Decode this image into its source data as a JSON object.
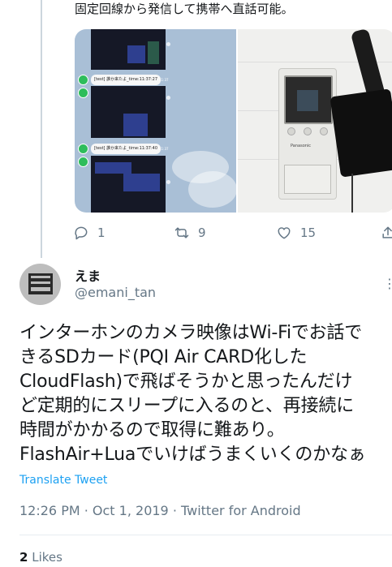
{
  "previous_tweet": {
    "text": "固定回線から発信して携帯へ直話可能。",
    "media": {
      "left_image": {
        "messages": [
          {
            "bubble": "[test] 誰か来たよ_time:11:37:27",
            "time": "11:37"
          },
          {
            "bubble": "[test] 誰か来たよ_time:11:37:40",
            "time": "11:37"
          }
        ]
      }
    },
    "actions": {
      "reply_count": "1",
      "retweet_count": "9",
      "like_count": "15"
    }
  },
  "tweet": {
    "author": {
      "display_name": "えま",
      "username": "@emani_tan"
    },
    "more_icon": "more-dots-icon",
    "text_lines": [
      "インターホンのカメラ映像はWi-Fiでお話で",
      "きるSDカード(PQI Air CARD化した",
      "CloudFlash)で飛ばそうかと思ったんだけ",
      "ど定期的にスリープに入るのと、再接続に",
      "時間がかかるので取得に難あり。",
      "FlashAir+Luaでいけばうまくいくのかなぁ"
    ],
    "translate_label": "Translate Tweet",
    "meta": "12:26 PM · Oct 1, 2019 · Twitter for Android",
    "likes_count": "2",
    "likes_label": "Likes"
  },
  "colors": {
    "accent": "#1da1f2",
    "secondary_text": "#657786",
    "primary_text": "#14171a",
    "divider": "#e6ecf0"
  }
}
